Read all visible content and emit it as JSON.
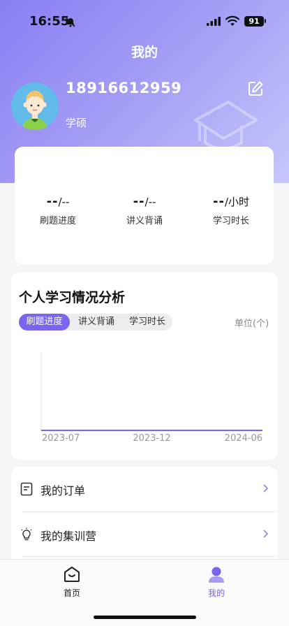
{
  "status": {
    "time": "16:55",
    "battery": "91"
  },
  "header": {
    "title": "我的"
  },
  "profile": {
    "phone": "18916612959",
    "degree": "学硕"
  },
  "stats": [
    {
      "value": "--",
      "suffix": "/--",
      "label": "刷题进度"
    },
    {
      "value": "--",
      "suffix": "/--",
      "label": "讲义背诵"
    },
    {
      "value": "--",
      "suffix": "/小时",
      "label": "学习时长"
    }
  ],
  "analysis": {
    "title": "个人学习情况分析",
    "tabs": [
      "刷题进度",
      "讲义背诵",
      "学习时长"
    ],
    "active_tab": 0,
    "unit": "单位(个)"
  },
  "chart_data": {
    "type": "line",
    "categories": [
      "2023-07",
      "2023-12",
      "2024-06"
    ],
    "series": [
      {
        "values": [
          0,
          0,
          0
        ]
      }
    ],
    "title": "",
    "xlabel": "",
    "ylabel": "",
    "line_color": "#7a66ee"
  },
  "menu": {
    "items": [
      {
        "label": "我的订单",
        "icon": "order-icon"
      },
      {
        "label": "我的集训营",
        "icon": "lightbulb-icon"
      }
    ]
  },
  "tabbar": {
    "items": [
      {
        "label": "首页",
        "icon": "home-icon",
        "active": false
      },
      {
        "label": "我的",
        "icon": "user-icon",
        "active": true
      }
    ]
  },
  "colors": {
    "accent": "#7a66ee",
    "hero_start": "#8a7ef3",
    "hero_end": "#c7c6fb"
  }
}
